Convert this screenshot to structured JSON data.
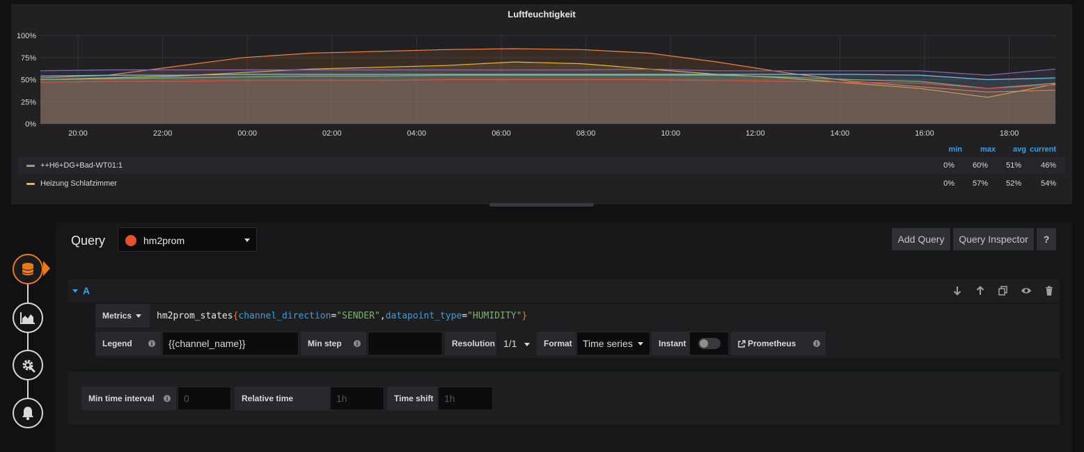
{
  "panel": {
    "title": "Luftfeuchtigkeit",
    "legend_headers": [
      "min",
      "max",
      "avg",
      "current"
    ],
    "legend_rows": [
      {
        "name": "++H6+DG+Bad-WT01:1",
        "color": "#7eb26d",
        "min": "0%",
        "max": "60%",
        "avg": "51%",
        "current": "46%"
      },
      {
        "name": "Heizung Schlafzimmer",
        "color": "#eab839",
        "min": "0%",
        "max": "57%",
        "avg": "52%",
        "current": "54%"
      }
    ]
  },
  "chart_data": {
    "type": "line",
    "y_ticks": [
      "100%",
      "75%",
      "50%",
      "25%",
      "0%"
    ],
    "x_ticks": [
      "20:00",
      "22:00",
      "00:00",
      "02:00",
      "04:00",
      "06:00",
      "08:00",
      "10:00",
      "12:00",
      "14:00",
      "16:00",
      "18:00"
    ],
    "ylim": [
      0,
      100
    ],
    "grid": true,
    "series": [
      {
        "color": "#ef843c",
        "values": [
          52,
          55,
          65,
          75,
          80,
          82,
          84,
          85,
          84,
          80,
          70,
          58,
          48,
          42,
          36,
          38
        ]
      },
      {
        "color": "#eab839",
        "values": [
          50,
          52,
          54,
          58,
          62,
          64,
          66,
          70,
          68,
          62,
          56,
          52,
          46,
          40,
          30,
          45
        ]
      },
      {
        "color": "#7eb26d",
        "values": [
          50,
          51,
          52,
          53,
          54,
          54,
          55,
          55,
          55,
          55,
          55,
          53,
          50,
          48,
          40,
          46
        ]
      },
      {
        "color": "#6ed0e0",
        "values": [
          54,
          55,
          55,
          56,
          56,
          56,
          56,
          56,
          56,
          56,
          56,
          56,
          56,
          55,
          50,
          52
        ]
      },
      {
        "color": "#806eb7",
        "values": [
          60,
          61,
          61,
          61,
          61,
          61,
          61,
          61,
          61,
          62,
          60,
          60,
          60,
          60,
          55,
          62
        ]
      },
      {
        "color": "#e24d42",
        "values": [
          47,
          48,
          48,
          49,
          49,
          49,
          50,
          50,
          50,
          50,
          49,
          48,
          47,
          46,
          40,
          44
        ]
      }
    ]
  },
  "nav": {
    "items": [
      "queries",
      "visualization",
      "general",
      "alert"
    ]
  },
  "query": {
    "label": "Query",
    "datasource": "hm2prom",
    "add_query": "Add Query",
    "query_inspector": "Query Inspector",
    "help": "?",
    "row_letter": "A",
    "metrics_label": "Metrics",
    "expr": {
      "fn": "hm2prom_states",
      "open": "{",
      "k1": "channel_direction",
      "eq1": "=",
      "v1": "\"SENDER\"",
      "comma": ",",
      "k2": "datapoint_type",
      "eq2": "=",
      "v2": "\"HUMIDITY\"",
      "close": "}"
    },
    "legend_label": "Legend",
    "legend_value": "{{channel_name}}",
    "min_step_label": "Min step",
    "min_step_value": "",
    "resolution_label": "Resolution",
    "resolution_value": "1/1",
    "format_label": "Format",
    "format_value": "Time series",
    "instant_label": "Instant",
    "prometheus_link": "Prometheus"
  },
  "options": {
    "min_interval_label": "Min time interval",
    "min_interval_placeholder": "0",
    "relative_time_label": "Relative time",
    "relative_time_placeholder": "1h",
    "time_shift_label": "Time shift",
    "time_shift_placeholder": "1h"
  }
}
